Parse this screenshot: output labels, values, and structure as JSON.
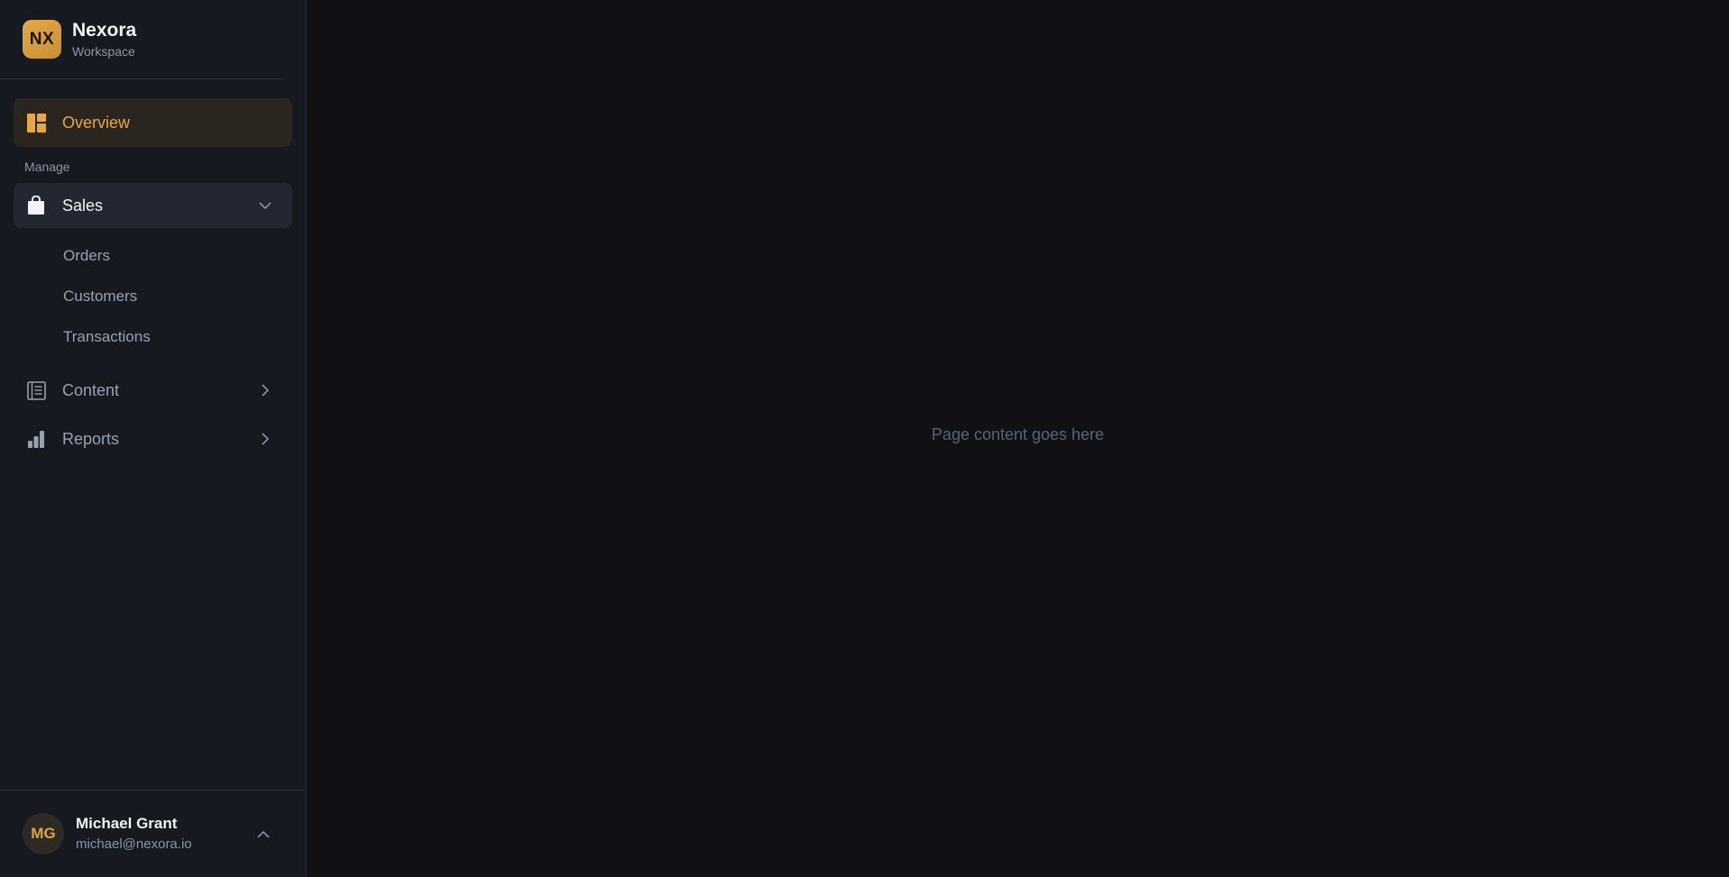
{
  "brand": {
    "logo_text": "NX",
    "name": "Nexora",
    "subtitle": "Workspace",
    "accent": "#e3a84a"
  },
  "nav": {
    "overview": {
      "label": "Overview",
      "icon": "dashboard-icon"
    },
    "section_label": "Manage",
    "sales": {
      "label": "Sales",
      "icon": "shopping-bag-icon",
      "expanded": true,
      "children": [
        {
          "label": "Orders"
        },
        {
          "label": "Customers"
        },
        {
          "label": "Transactions"
        }
      ]
    },
    "content": {
      "label": "Content",
      "icon": "document-list-icon"
    },
    "reports": {
      "label": "Reports",
      "icon": "bar-chart-icon"
    }
  },
  "user": {
    "initials": "MG",
    "name": "Michael Grant",
    "email": "michael@nexora.io"
  },
  "main": {
    "placeholder": "Page content goes here"
  }
}
